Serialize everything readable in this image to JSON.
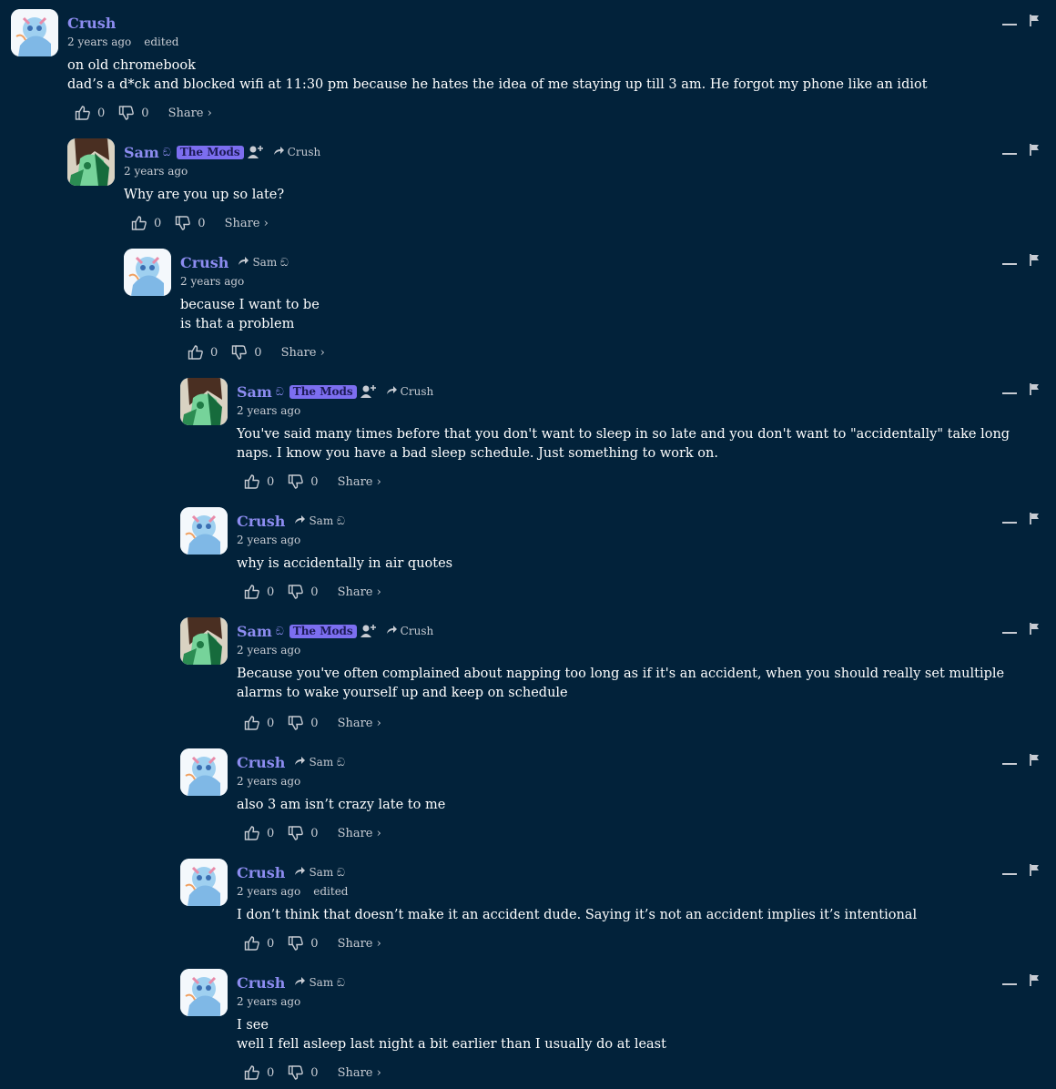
{
  "labels": {
    "share": "Share ›",
    "edited": "edited"
  },
  "colors": {
    "background": "#02223a",
    "author": "#8d8cf0",
    "badge": "#7c6ef0",
    "muted": "#c8ccd3"
  },
  "comments": [
    {
      "author": "Crush",
      "avatar": "crush-avatar",
      "time": "2 years ago",
      "edited": "edited",
      "lines": [
        "on old chromebook",
        "dad’s a d*ck and blocked wifi at 11:30 pm because he hates the idea of me staying up till 3 am. He forgot my phone like an idiot"
      ],
      "likes": "0",
      "dislikes": "0"
    },
    {
      "author": "Sam",
      "sigil": "ඞ",
      "badge": "The Mods",
      "reply_to": "Crush",
      "avatar": "sam-avatar",
      "time": "2 years ago",
      "lines": [
        "Why are you up so late?"
      ],
      "likes": "0",
      "dislikes": "0"
    },
    {
      "author": "Crush",
      "reply_to": "Sam ඞ",
      "avatar": "crush-avatar",
      "time": "2 years ago",
      "lines": [
        "because I want to be",
        "is that a problem"
      ],
      "likes": "0",
      "dislikes": "0"
    },
    {
      "author": "Sam",
      "sigil": "ඞ",
      "badge": "The Mods",
      "reply_to": "Crush",
      "avatar": "sam-avatar",
      "time": "2 years ago",
      "lines": [
        "You've said many times before that you don't want to sleep in so late and you don't want to \"accidentally\" take long naps. I know you have a bad sleep schedule. Just something to work on."
      ],
      "likes": "0",
      "dislikes": "0"
    },
    {
      "author": "Crush",
      "reply_to": "Sam ඞ",
      "avatar": "crush-avatar",
      "time": "2 years ago",
      "lines": [
        "why is accidentally in air quotes"
      ],
      "likes": "0",
      "dislikes": "0"
    },
    {
      "author": "Sam",
      "sigil": "ඞ",
      "badge": "The Mods",
      "reply_to": "Crush",
      "avatar": "sam-avatar",
      "time": "2 years ago",
      "lines": [
        "Because you've often complained about napping too long as if it's an accident, when you should really set multiple alarms to wake yourself up and keep on schedule"
      ],
      "likes": "0",
      "dislikes": "0"
    },
    {
      "author": "Crush",
      "reply_to": "Sam ඞ",
      "avatar": "crush-avatar",
      "time": "2 years ago",
      "lines": [
        "also 3 am isn’t crazy late to me"
      ],
      "likes": "0",
      "dislikes": "0"
    },
    {
      "author": "Crush",
      "reply_to": "Sam ඞ",
      "avatar": "crush-avatar",
      "time": "2 years ago",
      "edited": "edited",
      "lines": [
        "I don’t think that doesn’t make it an accident dude. Saying it’s not an accident implies it’s intentional"
      ],
      "likes": "0",
      "dislikes": "0"
    },
    {
      "author": "Crush",
      "reply_to": "Sam ඞ",
      "avatar": "crush-avatar",
      "time": "2 years ago",
      "lines": [
        "I see",
        "well I fell asleep last night a bit earlier than I usually do at least"
      ],
      "likes": "0",
      "dislikes": "0"
    }
  ]
}
